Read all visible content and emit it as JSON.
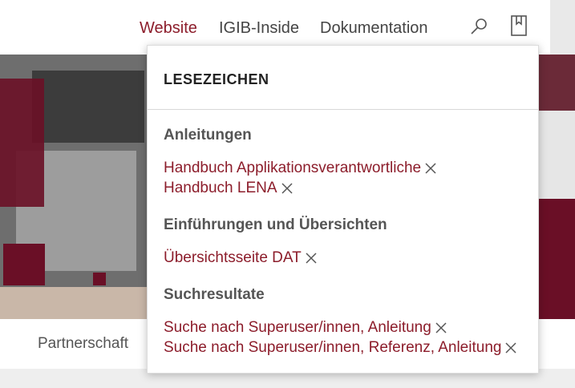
{
  "nav": {
    "website": "Website",
    "inside": "IGIB-Inside",
    "docs": "Dokumentation"
  },
  "icons": {
    "search": "search-icon",
    "bookmark": "bookmark-icon",
    "remove": "close-icon"
  },
  "colors": {
    "accent": "#8c1d2b",
    "text": "#444444",
    "heading": "#555555"
  },
  "panel": {
    "title": "LESEZEICHEN",
    "groups": [
      {
        "title": "Anleitungen",
        "items": [
          "Handbuch Applikationsverantwortliche",
          "Handbuch LENA"
        ]
      },
      {
        "title": "Einführungen und Übersichten",
        "items": [
          "Übersichtsseite DAT"
        ]
      },
      {
        "title": "Suchresultate",
        "items": [
          "Suche nach Superuser/innen, Anleitung",
          "Suche nach Superuser/innen, Referenz, Anleitung"
        ]
      }
    ]
  },
  "subnav": {
    "partner": "Partnerschaft"
  }
}
